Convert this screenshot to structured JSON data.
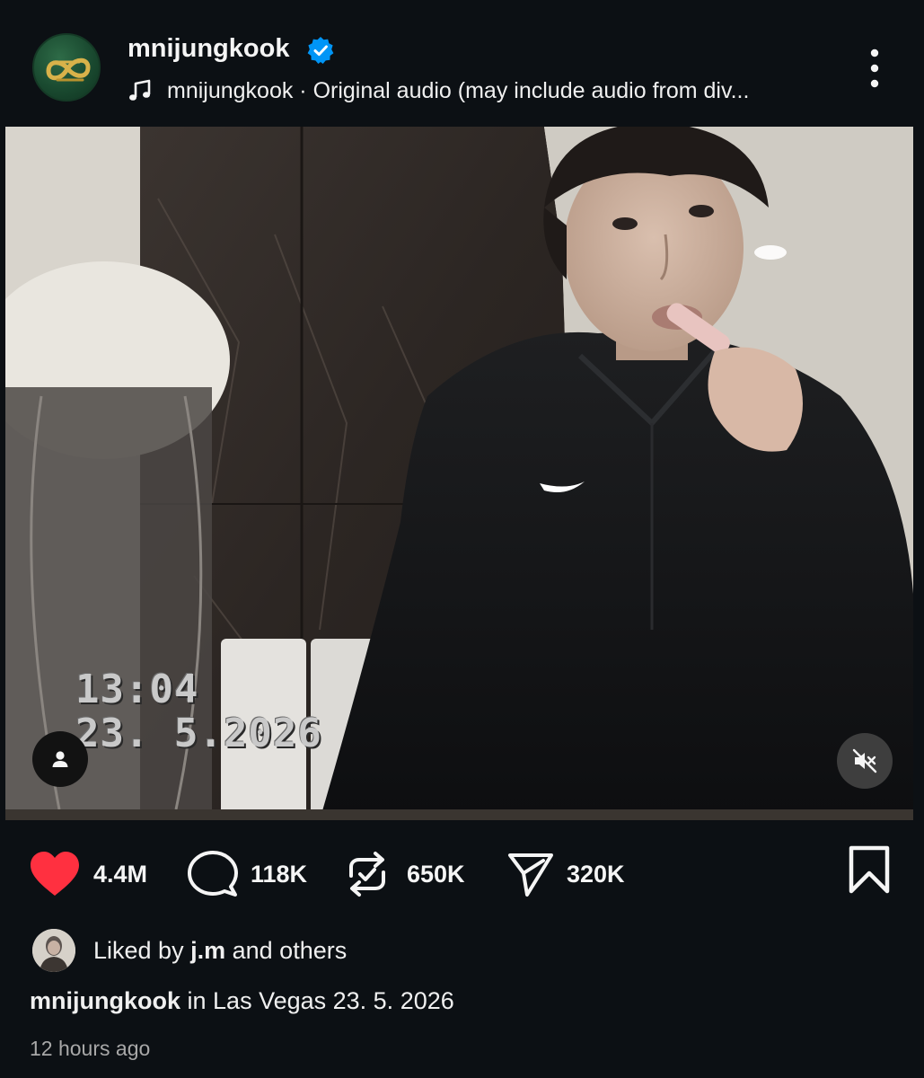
{
  "header": {
    "username": "mnijungkook",
    "verified": true,
    "audio_text": "mnijungkook · Original audio (may include audio from div...",
    "avatar_icon": "gold-infinity-logo",
    "more_icon": "three-dots-vertical-icon"
  },
  "media": {
    "overlay_time": "13:04",
    "overlay_date": "23.  5.2026",
    "tag_icon": "person-tag-icon",
    "mute_icon": "speaker-muted-icon"
  },
  "actions": {
    "likes": "4.4M",
    "comments": "118K",
    "reposts": "650K",
    "shares": "320K",
    "liked_state": true,
    "like_color": "#ff3040"
  },
  "liked_by": {
    "prefix": "Liked by",
    "user": "j.m",
    "suffix": "and others"
  },
  "caption": {
    "username": "mnijungkook",
    "text": "in Las Vegas 23. 5. 2026"
  },
  "timestamp": "12 hours ago",
  "colors": {
    "background": "#0c1014",
    "verified_blue": "#0095f6"
  }
}
